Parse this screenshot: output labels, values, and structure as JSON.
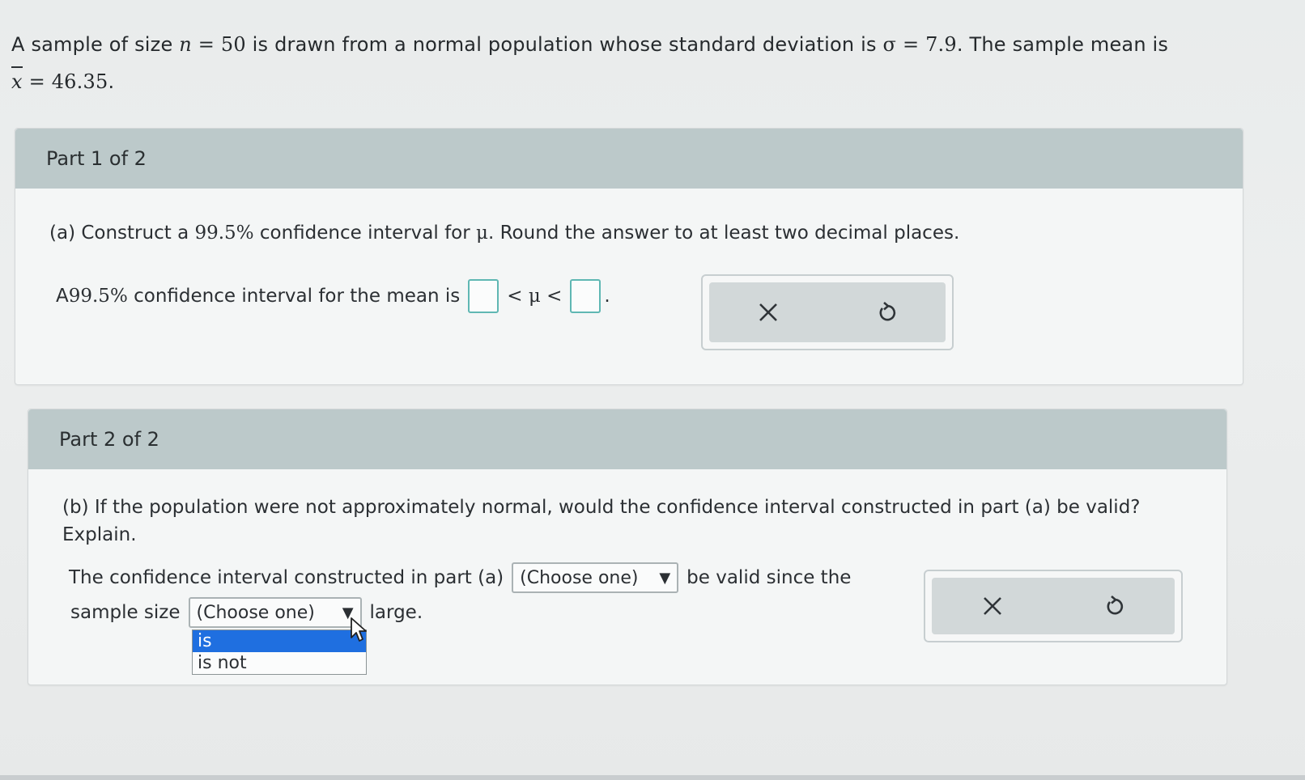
{
  "problem": {
    "seg1": "A sample of size ",
    "n_sym": "n",
    "eq1": " = 50",
    "seg2": " is drawn from a normal population whose standard deviation is ",
    "sigma_sym": "σ",
    "eq2": " = 7.9",
    "seg3": ". The sample mean is",
    "xbar_sym": "x",
    "eq3": " = 46.35",
    "seg4": "."
  },
  "part1": {
    "header": "Part 1 of 2",
    "question_prefix": "(a) Construct a ",
    "question_pct": "99.5%",
    "question_mid": " confidence interval for ",
    "question_mu": "μ",
    "question_suffix": ". Round the answer to at least two decimal places.",
    "answer_prefix": "A ",
    "answer_pct": "99.5%",
    "answer_mid": " confidence interval for the mean is",
    "answer_ineq": "< μ <",
    "answer_end": ".",
    "lower_bound_value": "",
    "upper_bound_value": ""
  },
  "part2": {
    "header": "Part 2 of 2",
    "question_line1": "(b) If the population were not approximately normal, would the confidence interval constructed in part (a) be valid?",
    "question_line2": "Explain.",
    "answer_prefix": "The confidence interval constructed in part (a)",
    "select1_value": "(Choose one)",
    "answer_mid": "be valid since the",
    "answer_line2_prefix": "sample size",
    "select2_value": "(Choose one)",
    "answer_suffix": "large.",
    "dropdown_options": [
      "is",
      "is not"
    ],
    "dropdown_selected": "is"
  },
  "icons": {
    "clear": "close-icon",
    "undo": "undo-icon",
    "caret": "▼",
    "accent_box": "#5fb7b3",
    "selection_blue": "#1f6fe0"
  }
}
